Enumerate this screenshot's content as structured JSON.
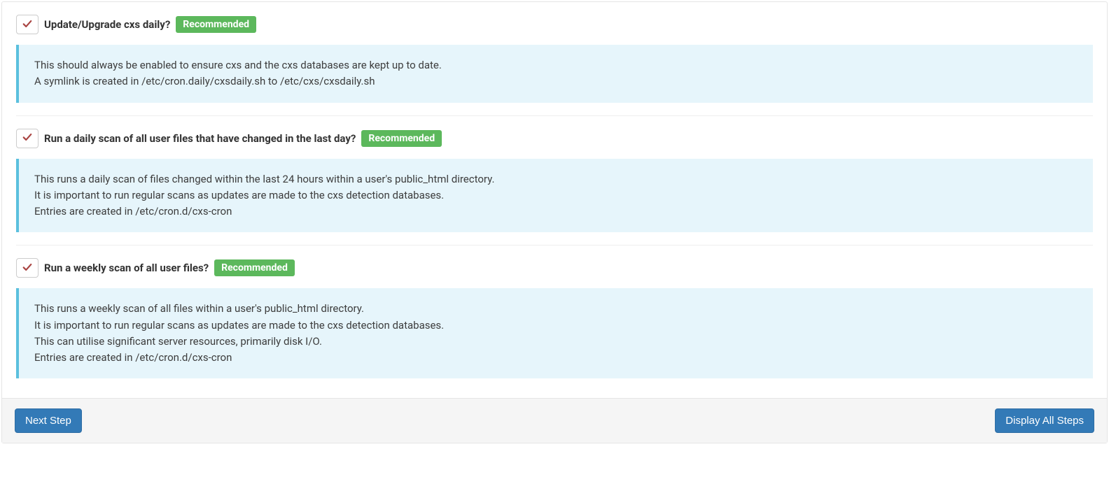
{
  "options": [
    {
      "title": "Update/Upgrade cxs daily?",
      "badge": "Recommended",
      "lines": [
        "This should always be enabled to ensure cxs and the cxs databases are kept up to date.",
        "A symlink is created in /etc/cron.daily/cxsdaily.sh to /etc/cxs/cxsdaily.sh"
      ]
    },
    {
      "title": "Run a daily scan of all user files that have changed in the last day?",
      "badge": "Recommended",
      "lines": [
        "This runs a daily scan of files changed within the last 24 hours within a user's public_html directory.",
        "It is important to run regular scans as updates are made to the cxs detection databases.",
        "Entries are created in /etc/cron.d/cxs-cron"
      ]
    },
    {
      "title": "Run a weekly scan of all user files?",
      "badge": "Recommended",
      "lines": [
        "This runs a weekly scan of all files within a user's public_html directory.",
        "It is important to run regular scans as updates are made to the cxs detection databases.",
        "This can utilise significant server resources, primarily disk I/O.",
        "Entries are created in /etc/cron.d/cxs-cron"
      ]
    }
  ],
  "footer": {
    "next_label": "Next Step",
    "display_all_label": "Display All Steps"
  }
}
